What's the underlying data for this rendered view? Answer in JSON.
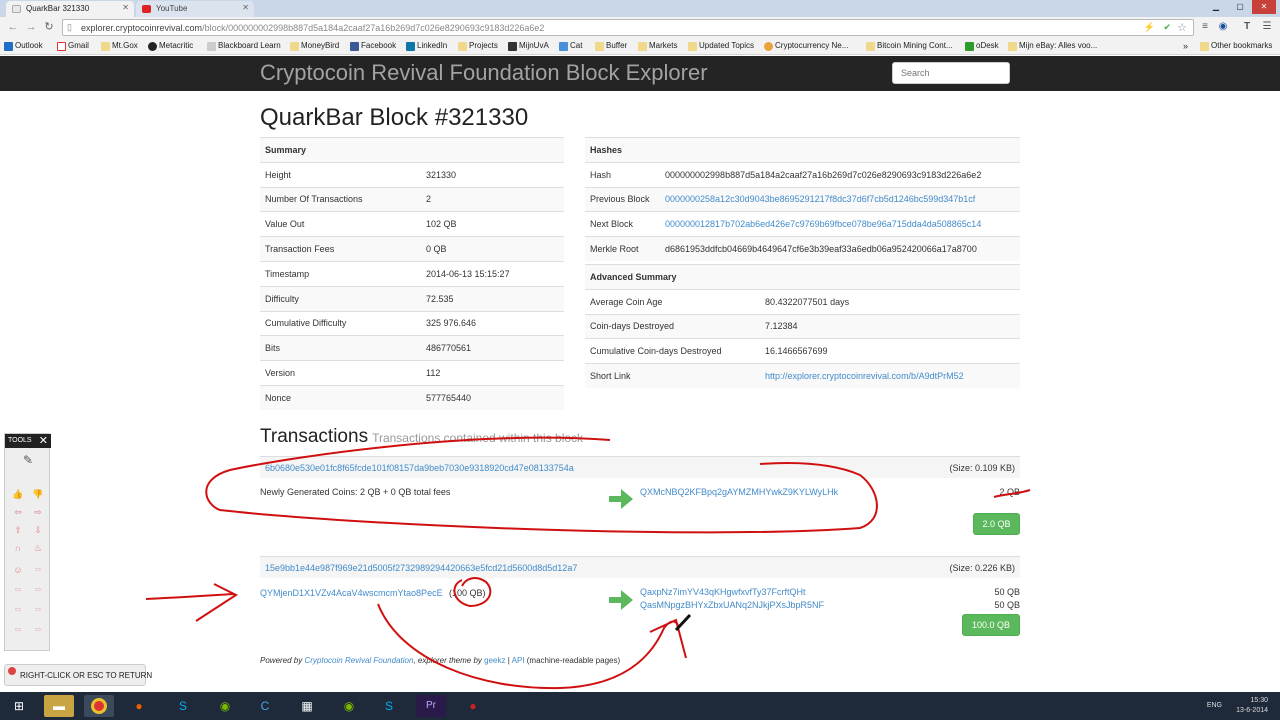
{
  "browser": {
    "tabs": [
      {
        "title": "QuarkBar 321330",
        "active": true
      },
      {
        "title": "YouTube",
        "active": false
      }
    ],
    "url_host": "explorer.cryptocoinrevival.com",
    "url_path": "/block/000000002998b887d5a184a2caaf27a16b269d7c026e8290693c9183d226a6e2",
    "bookmarks": [
      "Outlook",
      "Gmail",
      "Mt.Gox",
      "Metacritic",
      "Blackboard Learn",
      "MoneyBird",
      "Facebook",
      "LinkedIn",
      "Projects",
      "MijnUvA",
      "Cat",
      "Buffer",
      "Markets",
      "Updated Topics",
      "Cryptocurrency Ne...",
      "Bitcoin Mining Cont...",
      "oDesk",
      "Mijn eBay: Alles voo..."
    ],
    "bookmarks_more": "»",
    "other_bookmarks": "Other bookmarks"
  },
  "site": {
    "brand": "Cryptocoin Revival Foundation Block Explorer",
    "search_placeholder": "Search"
  },
  "page_title": "QuarkBar Block #321330",
  "summary": {
    "heading": "Summary",
    "rows": [
      {
        "label": "Height",
        "value": "321330"
      },
      {
        "label": "Number Of Transactions",
        "value": "2"
      },
      {
        "label": "Value Out",
        "value": "102 QB"
      },
      {
        "label": "Transaction Fees",
        "value": "0 QB"
      },
      {
        "label": "Timestamp",
        "value": "2014-06-13 15:15:27"
      },
      {
        "label": "Difficulty",
        "value": "72.535"
      },
      {
        "label": "Cumulative Difficulty",
        "value": "325 976.646"
      },
      {
        "label": "Bits",
        "value": "486770561"
      },
      {
        "label": "Version",
        "value": "112"
      },
      {
        "label": "Nonce",
        "value": "577765440"
      }
    ]
  },
  "hashes": {
    "heading": "Hashes",
    "rows": [
      {
        "label": "Hash",
        "value": "000000002998b887d5a184a2caaf27a16b269d7c026e8290693c9183d226a6e2",
        "link": false
      },
      {
        "label": "Previous Block",
        "value": "0000000258a12c30d9043be8695291217f8dc37d6f7cb5d1246bc599d347b1cf",
        "link": true
      },
      {
        "label": "Next Block",
        "value": "000000012817b702ab6ed426e7c9769b69fbce078be96a715dda4da508865c14",
        "link": true
      },
      {
        "label": "Merkle Root",
        "value": "d6861953ddfcb04669b4649647cf6e3b39eaf33a6edb06a952420066a17a8700",
        "link": false
      }
    ]
  },
  "advanced": {
    "heading": "Advanced Summary",
    "rows": [
      {
        "label": "Average Coin Age",
        "value": "80.4322077501 days",
        "link": false
      },
      {
        "label": "Coin-days Destroyed",
        "value": "7.12384",
        "link": false
      },
      {
        "label": "Cumulative Coin-days Destroyed",
        "value": "16.1466567699",
        "link": false
      },
      {
        "label": "Short Link",
        "value": "http://explorer.cryptocoinrevival.com/b/A9dtPrM52",
        "link": true
      }
    ]
  },
  "transactions": {
    "heading": "Transactions",
    "subheading": "Transactions contained within this block",
    "items": [
      {
        "hash": "6b0680e530e01fc8f65fcde101f08157da9beb7030e9318920cd47e08133754a",
        "size": "(Size: 0.109 KB)",
        "input_text": "Newly Generated Coins: 2 QB + 0 QB total fees",
        "outputs": [
          {
            "address": "QXMcNBQ2KFBpq2gAYMZMHYwkZ9KYLWyLHk",
            "amount": "2 QB"
          }
        ],
        "total": "2.0 QB"
      },
      {
        "hash": "15e9bb1e44e987f969e21d5005f2732989294420663e5fcd21d5600d8d5d12a7",
        "size": "(Size: 0.226 KB)",
        "input_address": "QYMjenD1X1VZv4AcaV4wscmcmYtao8PecE",
        "input_amount": "(100 QB)",
        "outputs": [
          {
            "address": "QaxpNz7imYV43qKHgwfxvfTy37FcrftQHt",
            "amount": "50 QB"
          },
          {
            "address": "QasMNpgzBHYxZbxUANq2NJkjPXsJbpR5NF",
            "amount": "50 QB"
          }
        ],
        "total": "100.0 QB"
      }
    ]
  },
  "footer": {
    "powered_by": "Powered by",
    "foundation": "Cryptocoin Revival Foundation",
    "theme_by": ", explorer theme by",
    "geekz": "geekz",
    "sep": "|",
    "api": "API",
    "api_note": "(machine-readable pages)"
  },
  "overlay": {
    "tools_label": "TOOLS",
    "close": "✕",
    "return_hint": "RIGHT-CLICK OR ESC TO RETURN"
  },
  "taskbar": {
    "time": "15:30",
    "date": "13-6-2014",
    "lang": "ENG"
  },
  "colors": {
    "link": "#428bca",
    "success": "#5cb85c",
    "annotation": "#d01010",
    "navbar": "#242424"
  }
}
